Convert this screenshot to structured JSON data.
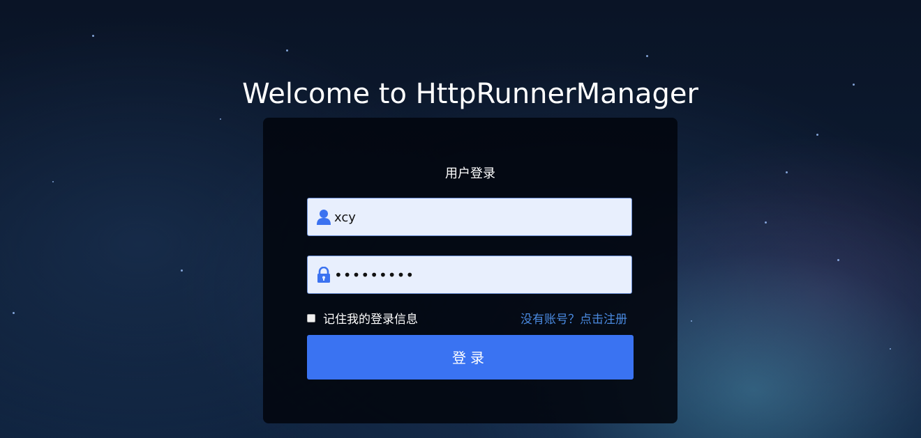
{
  "page": {
    "title": "Welcome to HttpRunnerManager"
  },
  "login": {
    "heading": "用户登录",
    "username": {
      "icon": "user-icon",
      "value": "xcy"
    },
    "password": {
      "icon": "lock-icon",
      "value": "•••••••••"
    },
    "remember": {
      "label": "记住我的登录信息",
      "checked": false
    },
    "register_link": "没有账号？点击注册",
    "submit_label": "登录"
  },
  "colors": {
    "accent": "#3a73f2",
    "link": "#4a8ae0",
    "input_bg": "#e8effd",
    "panel_bg": "#02060e"
  }
}
